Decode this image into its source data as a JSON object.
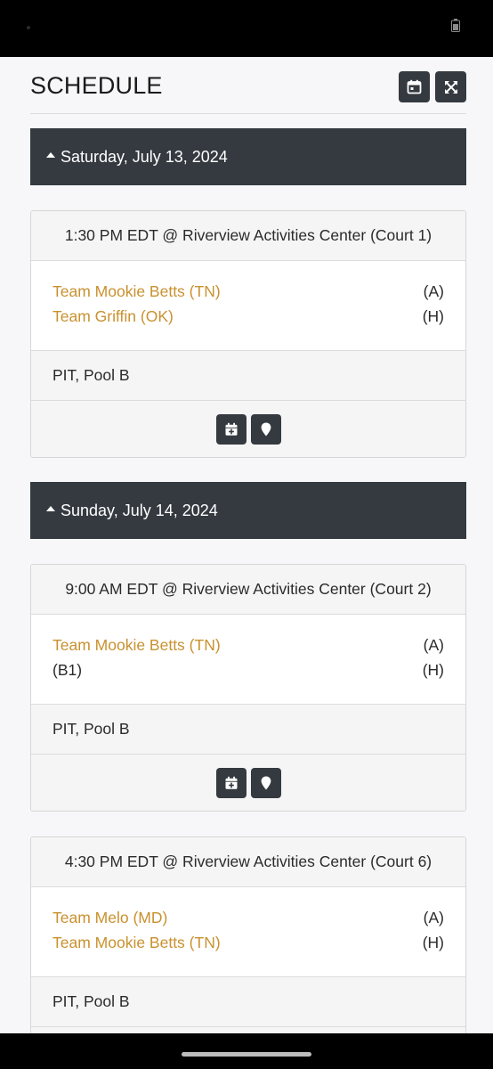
{
  "page": {
    "title": "SCHEDULE"
  },
  "header_buttons": {
    "calendar": "calendar-icon",
    "fullscreen": "expand-icon"
  },
  "days": [
    {
      "label": "Saturday, July 13, 2024",
      "games": [
        {
          "header": "1:30 PM EDT @ Riverview Activities Center (Court 1)",
          "team1": "Team Mookie Betts (TN)",
          "team1_side": "(A)",
          "team2": "Team Griffin (OK)",
          "team2_side": "(H)",
          "meta": "PIT, Pool B"
        }
      ]
    },
    {
      "label": "Sunday, July 14, 2024",
      "games": [
        {
          "header": "9:00 AM EDT @ Riverview Activities Center (Court 2)",
          "team1": "Team Mookie Betts (TN)",
          "team1_side": "(A)",
          "team2": "(B1)",
          "team2_side": "(H)",
          "meta": "PIT, Pool B"
        },
        {
          "header": "4:30 PM EDT @ Riverview Activities Center (Court 6)",
          "team1": "Team Melo (MD)",
          "team1_side": "(A)",
          "team2": "Team Mookie Betts (TN)",
          "team2_side": "(H)",
          "meta": "PIT, Pool B"
        }
      ]
    }
  ],
  "colors": {
    "dark": "#343a40",
    "team_link": "#c9912f",
    "background": "#f7f7f9"
  }
}
